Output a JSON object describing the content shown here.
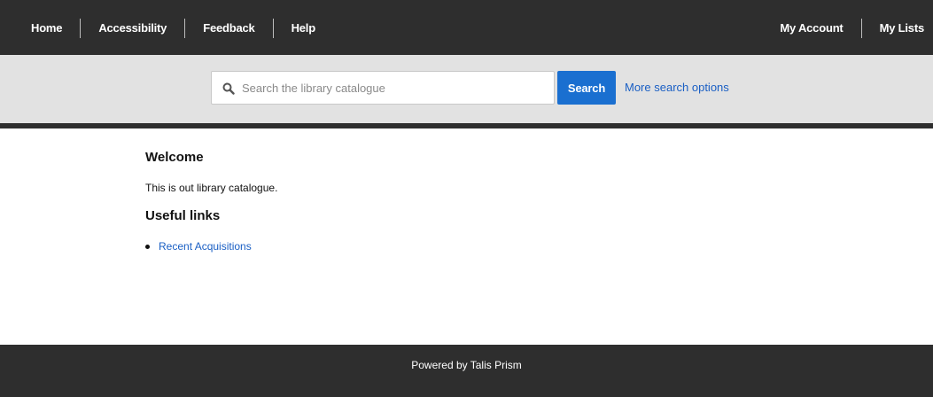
{
  "topnav": {
    "left": [
      {
        "label": "Home"
      },
      {
        "label": "Accessibility"
      },
      {
        "label": "Feedback"
      },
      {
        "label": "Help"
      }
    ],
    "right": [
      {
        "label": "My Account"
      },
      {
        "label": "My Lists"
      }
    ]
  },
  "search": {
    "placeholder": "Search the library catalogue",
    "value": "",
    "button_label": "Search",
    "more_options_label": "More search options"
  },
  "main": {
    "welcome_heading": "Welcome",
    "welcome_text": "This is out library catalogue.",
    "links_heading": "Useful links",
    "links": [
      {
        "label": "Recent Acquisitions"
      }
    ]
  },
  "footer": {
    "text": "Powered by Talis Prism"
  },
  "colors": {
    "header_bg": "#2e2e2e",
    "search_bar_bg": "#e2e2e2",
    "accent_blue": "#1a6fd0",
    "link_blue": "#1a5fc4"
  },
  "icons": {
    "search": "search-icon"
  }
}
